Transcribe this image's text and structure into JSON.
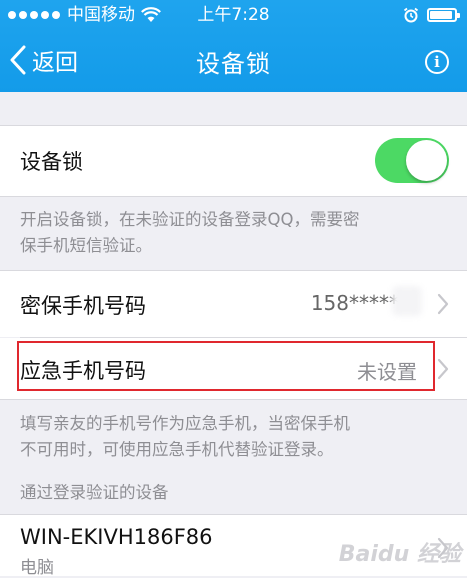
{
  "status_bar": {
    "carrier": "中国移动",
    "time": "上午7:28"
  },
  "nav": {
    "back_label": "返回",
    "title": "设备锁"
  },
  "device_lock": {
    "label": "设备锁",
    "enabled": true,
    "description_line1": "开启设备锁，在未验证的设备登录QQ，需要密",
    "description_line2": "保手机短信验证。"
  },
  "security_phone": {
    "label": "密保手机号码",
    "value": "158******"
  },
  "emergency_phone": {
    "label": "应急手机号码",
    "value": "未设置",
    "note_line1": "填写亲友的手机号作为应急手机，当密保手机",
    "note_line2": "不可用时，可使用应急手机代替验证登录。"
  },
  "verified_devices": {
    "section_header": "通过登录验证的设备",
    "items": [
      {
        "name": "WIN-EKIVH186F86",
        "type": "电脑"
      }
    ]
  },
  "watermark": "Baidu 经验",
  "colors": {
    "nav_blue": "#139be9",
    "toggle_on": "#4cd964",
    "highlight_red": "#e0282e"
  }
}
